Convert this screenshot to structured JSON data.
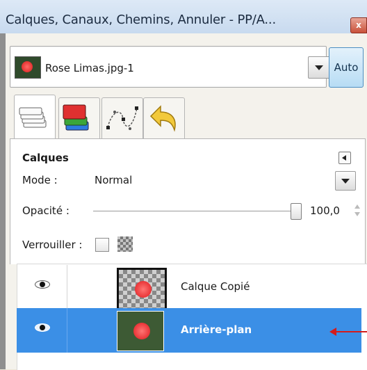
{
  "window": {
    "title": "Calques, Canaux, Chemins, Annuler - PP/A...",
    "close_label": "x"
  },
  "image_selector": {
    "name": "Rose Limas.jpg-1",
    "auto_label": "Auto"
  },
  "tabs": [
    {
      "name": "layers-tab",
      "icon": "layers-stack-icon"
    },
    {
      "name": "channels-tab",
      "icon": "channels-icon"
    },
    {
      "name": "paths-tab",
      "icon": "paths-icon"
    },
    {
      "name": "undo-history-tab",
      "icon": "undo-arrow-icon"
    }
  ],
  "layers_panel": {
    "title": "Calques",
    "mode_label": "Mode :",
    "mode_value": "Normal",
    "opacity_label": "Opacité :",
    "opacity_value": "100,0",
    "opacity_fraction": 1.0,
    "lock_label": "Verrouiller :"
  },
  "layers": [
    {
      "name": "Calque Copié",
      "visible": true,
      "selected": false
    },
    {
      "name": "Arrière-plan",
      "visible": true,
      "selected": true
    }
  ],
  "colors": {
    "selection": "#3b8fe6",
    "annotation_arrow": "#d41b1b",
    "auto_button": "#b7dcf4"
  }
}
